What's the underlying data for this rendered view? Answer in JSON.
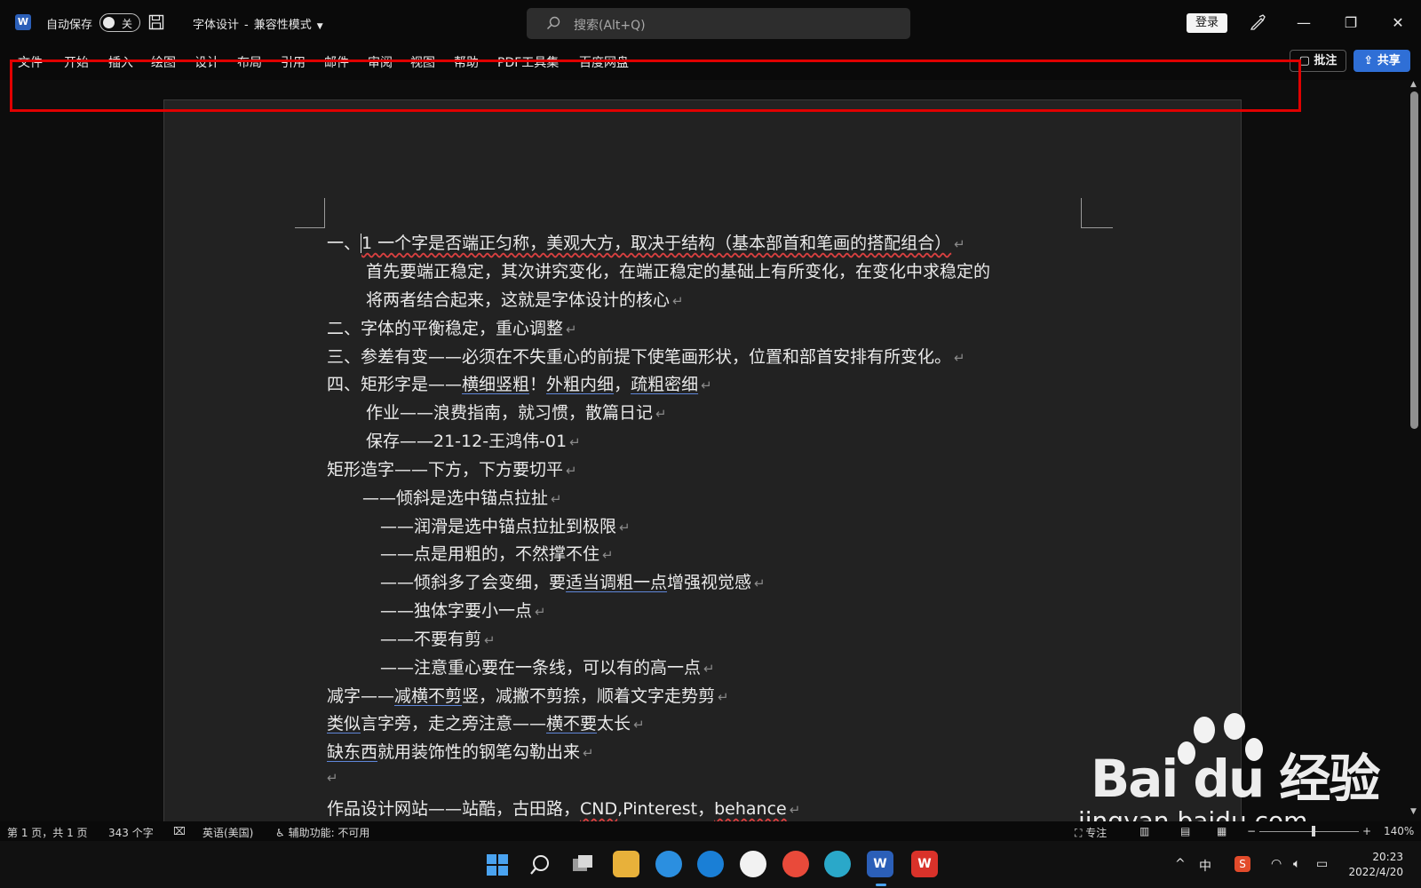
{
  "titlebar": {
    "app_icon": "word-icon",
    "autosave_label": "自动保存",
    "autosave_state": "关",
    "doc_name": "字体设计",
    "separator": "-",
    "mode": "兼容性模式",
    "search_placeholder": "搜索(Alt+Q)",
    "login_label": "登录",
    "minimize": "—",
    "restore": "❐",
    "close": "✕"
  },
  "ribbon": {
    "tabs": [
      "文件",
      "开始",
      "插入",
      "绘图",
      "设计",
      "布局",
      "引用",
      "邮件",
      "审阅",
      "视图",
      "帮助",
      "PDF工具集",
      "百度网盘"
    ],
    "comment_label": "批注",
    "share_label": "共享"
  },
  "document": {
    "lines": [
      {
        "prefix": "一、",
        "text": "1 一个字是否端正匀称，美观大方，取决于结构（基本部首和笔画的搭配组合）"
      },
      {
        "text": "首先要端正稳定，其次讲究变化，在端正稳定的基础上有所变化，在变化中求稳定的"
      },
      {
        "text": "将两者结合起来，这就是字体设计的核心"
      },
      {
        "text": "二、字体的平衡稳定，重心调整"
      },
      {
        "text": "三、参差有变——必须在不失重心的前提下使笔画形状，位置和部首安排有所变化。"
      },
      {
        "text_a": "四、矩形字是——",
        "u1": "横细竖粗",
        "text_b": "！",
        "u2": "外粗内细",
        "text_c": "，",
        "u3": "疏粗密细"
      },
      {
        "text": "作业——浪费指南，就习惯，散篇日记"
      },
      {
        "text": "保存——21-12-王鸿伟-01"
      },
      {
        "text": "矩形造字——下方，下方要切平"
      },
      {
        "text": "——倾斜是选中锚点拉扯"
      },
      {
        "text": "——润滑是选中锚点拉扯到极限"
      },
      {
        "text": "——点是用粗的，不然撑不住"
      },
      {
        "text_a": "——倾斜多了会变细，要",
        "u1": "适当调粗一点",
        "text_b": "增强视觉感"
      },
      {
        "text": "——独体字要小一点"
      },
      {
        "text": "——不要有剪"
      },
      {
        "text": "——注意重心要在一条线，可以有的高一点"
      },
      {
        "text_a": "减字——",
        "u1": "减横不剪",
        "text_b": "竖，减撇不剪捺，顺着文字走势剪"
      },
      {
        "u1": "类似",
        "text_a": "言字旁，走之旁注意——",
        "u2": "横不要",
        "text_b": "太长"
      },
      {
        "u1": "缺东西",
        "text_a": "就用装饰性的钢笔勾勒出来"
      },
      {
        "text": ""
      },
      {
        "text_a": "作品设计网站——站酷，古田路，",
        "w1": "CND",
        "text_b": ",Pinterest，",
        "w2": "behance"
      }
    ],
    "paragraph_mark": "↵"
  },
  "statusbar": {
    "page": "第 1 页，共 1 页",
    "words": "343 个字",
    "language": "英语(美国)",
    "accessibility": "辅助功能: 不可用",
    "focus": "专注",
    "zoom_minus": "−",
    "zoom_plus": "+",
    "zoom": "140%"
  },
  "watermark": {
    "logo": "Bai du 经验",
    "url": "jingyan.baidu.com"
  },
  "taskbar": {
    "ime": "中",
    "time": "20:23",
    "date": "2022/4/20",
    "chevron": "^"
  }
}
